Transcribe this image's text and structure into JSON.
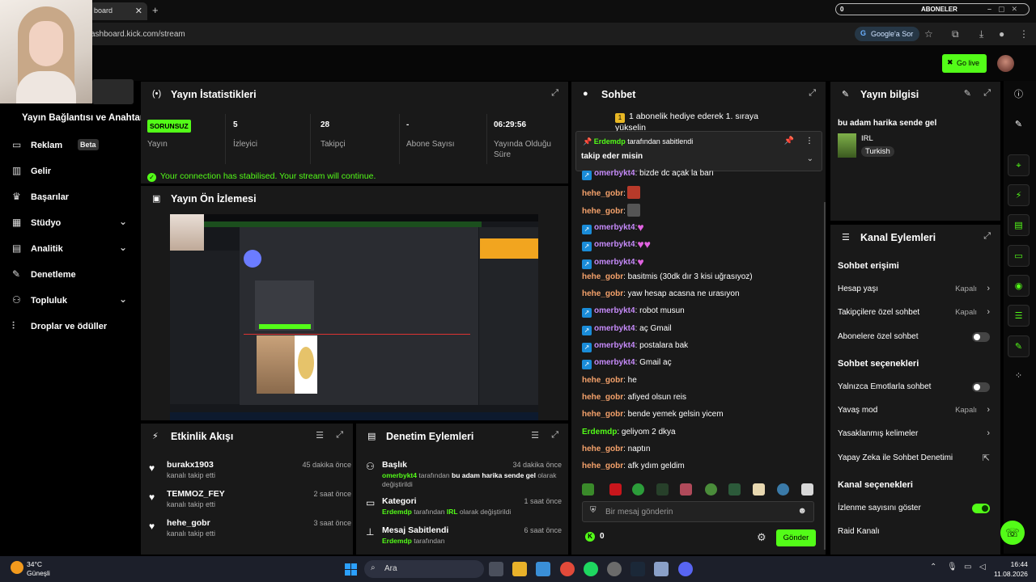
{
  "browser": {
    "tab_title": "board",
    "url": "ashboard.kick.com/stream",
    "google_ask": "Google'a Sor",
    "new_tab": "+",
    "close": "✕"
  },
  "subs_widget": {
    "count": "0",
    "label": "ABONELER"
  },
  "header": {
    "go_live": "Go live"
  },
  "sidebar": {
    "connection_key": "Yayın Bağlantısı ve Anahtarı",
    "items": [
      {
        "label": "Reklam",
        "badge": "Beta"
      },
      {
        "label": "Gelir"
      },
      {
        "label": "Başarılar"
      },
      {
        "label": "Stüdyo"
      },
      {
        "label": "Analitik"
      },
      {
        "label": "Denetleme"
      },
      {
        "label": "Topluluk"
      },
      {
        "label": "Droplar ve ödüller"
      }
    ]
  },
  "stats": {
    "title": "Yayın İstatistikleri",
    "status_badge": "SORUNSUZ",
    "items": [
      {
        "value": "",
        "label": "Yayın"
      },
      {
        "value": "5",
        "label": "İzleyici"
      },
      {
        "value": "28",
        "label": "Takipçi"
      },
      {
        "value": "-",
        "label": "Abone Sayısı"
      },
      {
        "value": "06:29:56",
        "label": "Yayında Olduğu Süre"
      }
    ],
    "connection_msg": "Your connection has stabilised. Your stream will continue."
  },
  "preview": {
    "title": "Yayın Ön İzlemesi"
  },
  "events": {
    "title": "Etkinlik Akışı",
    "items": [
      {
        "name": "burakx1903",
        "sub": "kanalı takip etti",
        "time": "45 dakika önce"
      },
      {
        "name": "TEMMOZ_FEY",
        "sub": "kanalı takip etti",
        "time": "2 saat önce"
      },
      {
        "name": "hehe_gobr",
        "sub": "kanalı takip etti",
        "time": "3 saat önce"
      }
    ]
  },
  "moderation": {
    "title": "Denetim Eylemleri",
    "items": [
      {
        "title": "Başlık",
        "time": "34 dakika önce",
        "user": "omerbykt4",
        "mid": " tarafından ",
        "bold": "bu adam harika sende gel",
        "end": " olarak değiştirildi"
      },
      {
        "title": "Kategori",
        "time": "1 saat önce",
        "user": "Erdemdp",
        "mid": " tarafından ",
        "bold": "IRL",
        "end": " olarak değiştirildi"
      },
      {
        "title": "Mesaj Sabitlendi",
        "time": "6 saat önce",
        "user": "Erdemdp",
        "mid": " tarafından",
        "bold": "",
        "end": ""
      }
    ]
  },
  "chat": {
    "title": "Sohbet",
    "promo": "1 abonelik hediye ederek 1. sıraya yükselin",
    "pinned_by": "Erdemdp",
    "pinned_suffix": " tarafından sabitlendi",
    "pinned_msg": "takip eder misin",
    "messages": [
      {
        "user": "omerbykt4",
        "text": ": bizde dc açak la barı",
        "badge": true,
        "color": "#c58af9"
      },
      {
        "user": "hehe_gobr",
        "text": ":",
        "badge": false,
        "color": "#f5a26b"
      },
      {
        "user": "hehe_gobr",
        "text": ":",
        "badge": false,
        "color": "#f5a26b"
      },
      {
        "user": "omerbykt4",
        "text": ":",
        "badge": true,
        "color": "#c58af9"
      },
      {
        "user": "omerbykt4",
        "text": ":",
        "badge": true,
        "color": "#c58af9"
      },
      {
        "user": "omerbykt4",
        "text": ":",
        "badge": true,
        "color": "#c58af9"
      },
      {
        "user": "hehe_gobr",
        "text": ": basitmis (30dk dır 3 kisi uğrasıyoz)",
        "badge": false,
        "color": "#f5a26b"
      },
      {
        "user": "hehe_gobr",
        "text": ": yaw hesap acasna ne urasıyon",
        "badge": false,
        "color": "#f5a26b"
      },
      {
        "user": "omerbykt4",
        "text": ": robot musun",
        "badge": true,
        "color": "#c58af9"
      },
      {
        "user": "omerbykt4",
        "text": ": aç Gmail",
        "badge": true,
        "color": "#c58af9"
      },
      {
        "user": "omerbykt4",
        "text": ": postalara bak",
        "badge": true,
        "color": "#c58af9"
      },
      {
        "user": "omerbykt4",
        "text": ": Gmail aç",
        "badge": true,
        "color": "#c58af9"
      },
      {
        "user": "hehe_gobr",
        "text": ": he",
        "badge": false,
        "color": "#f5a26b"
      },
      {
        "user": "hehe_gobr",
        "text": ": afiyed olsun reis",
        "badge": false,
        "color": "#f5a26b"
      },
      {
        "user": "hehe_gobr",
        "text": ": bende yemek gelsin yicem",
        "badge": false,
        "color": "#f5a26b"
      },
      {
        "user": "Erdemdp",
        "text": ": geliyom 2 dkya",
        "badge": false,
        "color": "#53fc18"
      },
      {
        "user": "hehe_gobr",
        "text": ": naptın",
        "badge": false,
        "color": "#f5a26b"
      },
      {
        "user": "hehe_gobr",
        "text": ": afk ydım geldim",
        "badge": false,
        "color": "#f5a26b"
      }
    ],
    "input_placeholder": "Bir mesaj gönderin",
    "coins": "0",
    "send_label": "Gönder"
  },
  "stream_info": {
    "title": "Yayın bilgisi",
    "stream_title": "bu adam harika sende gel",
    "category": "IRL",
    "language": "Turkish"
  },
  "channel_actions": {
    "title": "Kanal Eylemleri",
    "chat_access": "Sohbet erişimi",
    "account_age": "Hesap yaşı",
    "account_age_val": "Kapalı",
    "followers_only": "Takipçilere özel sohbet",
    "followers_only_val": "Kapalı",
    "subs_only": "Abonelere özel sohbet",
    "chat_options": "Sohbet seçenekleri",
    "emote_only": "Yalnızca Emotlarla sohbet",
    "slow_mode": "Yavaş mod",
    "slow_mode_val": "Kapalı",
    "banned_words": "Yasaklanmış kelimeler",
    "ai_mod": "Yapay Zeka ile Sohbet Denetimi",
    "channel_options": "Kanal seçenekleri",
    "show_viewers": "İzlenme sayısını göster",
    "raid": "Raid Kanalı"
  },
  "taskbar": {
    "temp": "34°C",
    "weather": "Güneşli",
    "search": "Ara",
    "time": "16:44",
    "date": "11.08.2026"
  },
  "colors": {
    "accent": "#53fc18",
    "panel": "#191919"
  }
}
